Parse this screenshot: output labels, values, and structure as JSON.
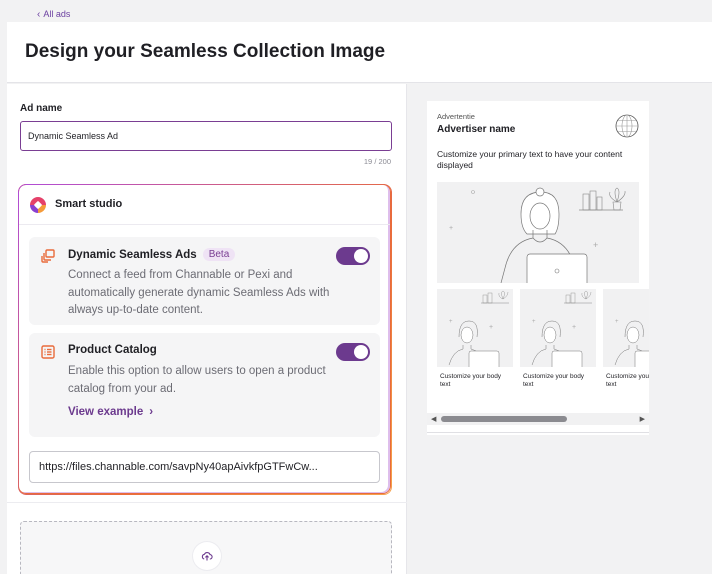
{
  "nav": {
    "back_label": "All ads"
  },
  "page": {
    "title": "Design your Seamless Collection Image"
  },
  "ad_name": {
    "label": "Ad name",
    "value": "Dynamic Seamless Ad",
    "counter": "19 / 200"
  },
  "smart_studio": {
    "title": "Smart studio",
    "features": [
      {
        "title": "Dynamic Seamless Ads",
        "badge": "Beta",
        "description": "Connect a feed from Channable or Pexi and automatically generate dynamic Seamless Ads with always up-to-date content.",
        "enabled": true,
        "icon": "layers-icon"
      },
      {
        "title": "Product Catalog",
        "description": "Enable this option to allow users to open a product catalog from your ad.",
        "link_label": "View example",
        "enabled": true,
        "icon": "catalog-list-icon"
      }
    ],
    "feed_url": "https://files.channable.com/savpNy40apAivkfpGTFwCw..."
  },
  "upload": {
    "icon": "upload-cloud-icon"
  },
  "preview": {
    "sponsored_label": "Advertentie",
    "advertiser_name": "Advertiser name",
    "primary_text": "Customize your primary text to have your content displayed",
    "cards": [
      {
        "caption": "Customize your body text"
      },
      {
        "caption": "Customize your body text"
      },
      {
        "caption": "Customize your body text"
      }
    ]
  },
  "colors": {
    "accent": "#6c3a8e",
    "studio_border_start": "#b04cd8",
    "studio_border_end": "#e96b3b",
    "background": "#f2f2f3"
  }
}
